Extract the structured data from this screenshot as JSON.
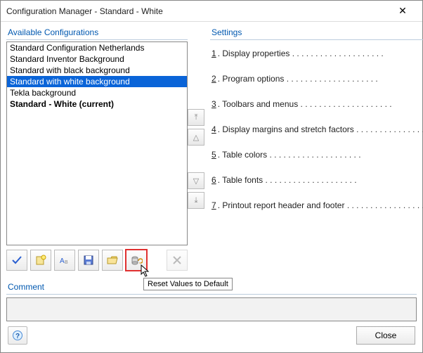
{
  "window": {
    "title": "Configuration Manager - Standard - White"
  },
  "left": {
    "group_label": "Available Configurations",
    "items": [
      {
        "label": "Standard Configuration Netherlands",
        "selected": false,
        "current": false
      },
      {
        "label": "Standard Inventor Background",
        "selected": false,
        "current": false
      },
      {
        "label": "Standard with black background",
        "selected": false,
        "current": false
      },
      {
        "label": "Standard with white background",
        "selected": true,
        "current": false
      },
      {
        "label": "Tekla background",
        "selected": false,
        "current": false
      },
      {
        "label": "Standard - White (current)",
        "selected": false,
        "current": true
      }
    ]
  },
  "reorder": {
    "top": "⤒",
    "up": "△",
    "down": "▽",
    "bottom": "⤓"
  },
  "toolbar": {
    "apply": "apply",
    "new": "new",
    "rename": "rename",
    "save": "save",
    "open": "open",
    "reset": "reset",
    "delete": "delete"
  },
  "tooltip": "Reset Values to Default",
  "comment": {
    "label": "Comment",
    "value": ""
  },
  "settings": {
    "group_label": "Settings",
    "rows": [
      {
        "num": "1",
        "label": "Display properties"
      },
      {
        "num": "2",
        "label": "Program options"
      },
      {
        "num": "3",
        "label": "Toolbars and menus"
      },
      {
        "num": "4",
        "label": "Display margins and stretch factors"
      },
      {
        "num": "5",
        "label": "Table colors"
      },
      {
        "num": "6",
        "label": "Table fonts"
      },
      {
        "num": "7",
        "label": "Printout report header and footer"
      }
    ]
  },
  "footer": {
    "close": "Close"
  }
}
